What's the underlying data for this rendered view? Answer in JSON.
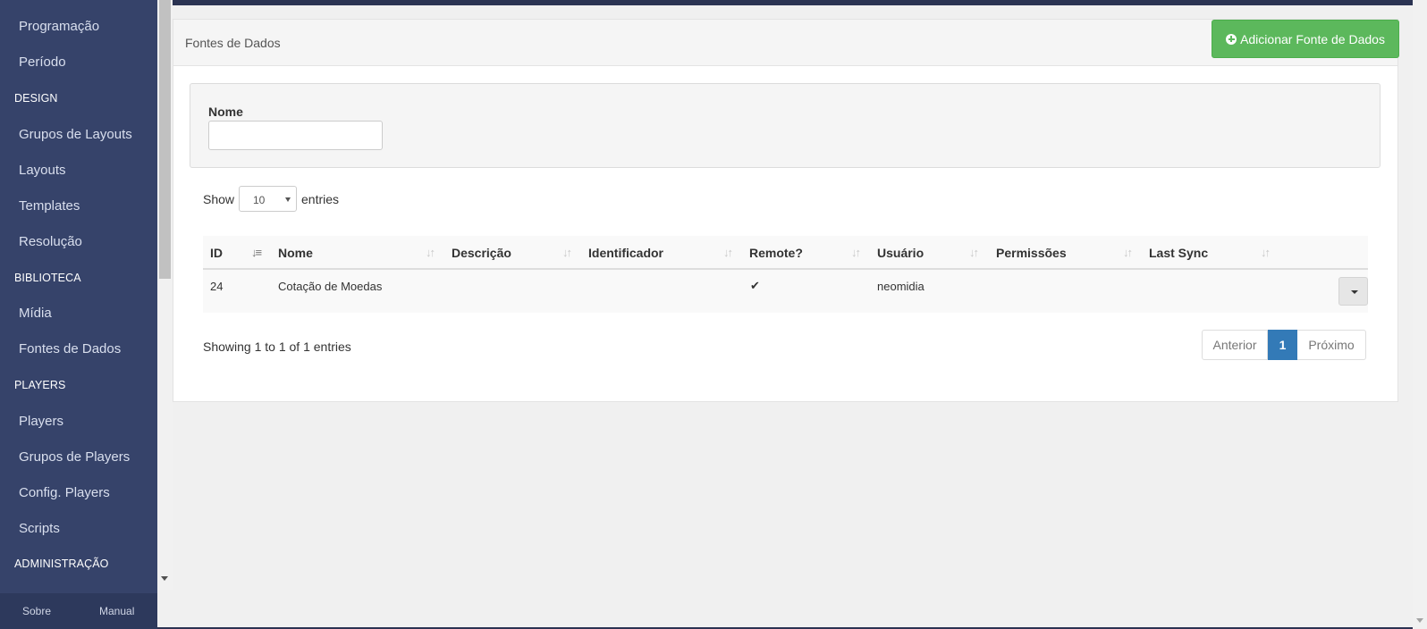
{
  "sidebar": {
    "items": [
      {
        "type": "item",
        "label": "Programação"
      },
      {
        "type": "item",
        "label": "Período"
      },
      {
        "type": "header",
        "label": "DESIGN"
      },
      {
        "type": "item",
        "label": "Grupos de Layouts"
      },
      {
        "type": "item",
        "label": "Layouts"
      },
      {
        "type": "item",
        "label": "Templates"
      },
      {
        "type": "item",
        "label": "Resolução"
      },
      {
        "type": "header",
        "label": "BIBLIOTECA"
      },
      {
        "type": "item",
        "label": "Mídia"
      },
      {
        "type": "item",
        "label": "Fontes de Dados"
      },
      {
        "type": "header",
        "label": "PLAYERS"
      },
      {
        "type": "item",
        "label": "Players"
      },
      {
        "type": "item",
        "label": "Grupos de Players"
      },
      {
        "type": "item",
        "label": "Config. Players"
      },
      {
        "type": "item",
        "label": "Scripts"
      },
      {
        "type": "header",
        "label": "ADMINISTRAÇÃO"
      }
    ],
    "footer": {
      "about": "Sobre",
      "manual": "Manual"
    }
  },
  "panel": {
    "title": "Fontes de Dados",
    "add_button": "Adicionar Fonte de Dados"
  },
  "filter": {
    "name_label": "Nome",
    "name_value": ""
  },
  "length_menu": {
    "show": "Show",
    "value": "10",
    "entries": "entries"
  },
  "table": {
    "columns": [
      "ID",
      "Nome",
      "Descrição",
      "Identificador",
      "Remote?",
      "Usuário",
      "Permissões",
      "Last Sync"
    ],
    "rows": [
      {
        "id": "24",
        "nome": "Cotação de Moedas",
        "descricao": "",
        "identificador": "",
        "remote": true,
        "usuario": "neomidia",
        "permissoes": "",
        "last_sync": ""
      }
    ]
  },
  "info": "Showing 1 to 1 of 1 entries",
  "pagination": {
    "prev": "Anterior",
    "current": "1",
    "next": "Próximo"
  },
  "colors": {
    "sidebar": "#36436a",
    "accent_green": "#5cb85c",
    "accent_blue": "#337ab7",
    "topbar": "#2b3352"
  }
}
